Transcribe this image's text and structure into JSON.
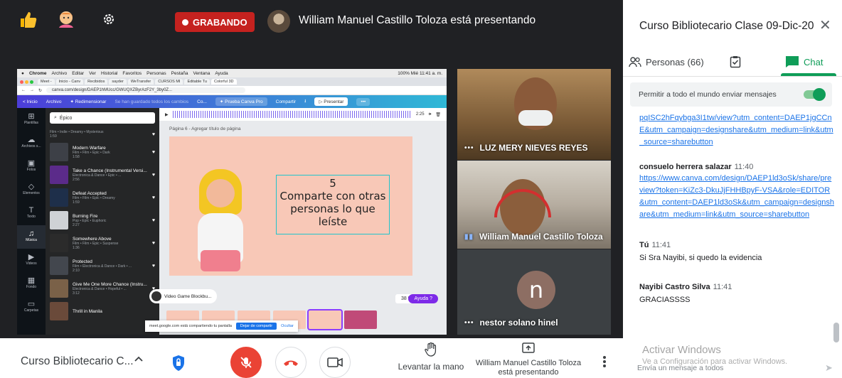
{
  "meet": {
    "recording_label": "GRABANDO",
    "presenter_title": "William Manuel Castillo Toloza está presentando",
    "icons": [
      "thumbs-up-icon",
      "emoji-icon",
      "settings-icon"
    ]
  },
  "shared_screen": {
    "mac_menu": [
      "Chrome",
      "Archivo",
      "Editar",
      "Ver",
      "Historial",
      "Favoritos",
      "Personas",
      "Pestaña",
      "Ventana",
      "Ayuda"
    ],
    "mac_status": "100% Mié 11:41 a. m.",
    "tabs": [
      "Meet - ",
      "Inicio - Canv",
      "Recibidos",
      "sayder",
      "WeTransfer",
      "CURSOS MI",
      "Editable Tu",
      "Colorful 3D"
    ],
    "url": "canva.com/design/DAEP1hMUcc/GWUQXZByrAzF2Y_3by0Z...",
    "canva_top": {
      "home": "< Inicio",
      "file": "Archivo",
      "resize": "✦ Redimensionar",
      "saved": "Se han guardado todos los cambios",
      "more": "Co...",
      "pro": "✦ Prueba Canva Pro",
      "share": "Compartir",
      "present": "▷ Presentar"
    },
    "rail": [
      "Plantillas",
      "Archivos s...",
      "Fotos",
      "Elementos",
      "Texto",
      "Música",
      "Videos",
      "Fondo",
      "Carpetas"
    ],
    "search_value": "Épico",
    "tracks": [
      {
        "title": "",
        "tags": "Film • Indie • Dreamy • Mysterious",
        "duration": "1:59"
      },
      {
        "title": "Modern Warfare",
        "tags": "Film • Film • Epic • Dark",
        "duration": "1:58"
      },
      {
        "title": "Take a Chance (Instrumental Versi...",
        "tags": "Electronica & Dance • Epic • ...",
        "duration": "2:56"
      },
      {
        "title": "Defeat Accepted",
        "tags": "Film • Film • Epic • Dreamy",
        "duration": "1:59"
      },
      {
        "title": "Burning Fire",
        "tags": "Pop • Epic • Euphoric",
        "duration": "2:27"
      },
      {
        "title": "Somewhere Above",
        "tags": "Film • Film • Epic • Suspense",
        "duration": "1:36"
      },
      {
        "title": "Protected",
        "tags": "Film • Electronica & Dance • Dark • ...",
        "duration": "2:10"
      },
      {
        "title": "Give Me One More Chance (Instru...",
        "tags": "Electronica & Dance • Hopeful • ...",
        "duration": "3:12"
      },
      {
        "title": "Thrill in Manila",
        "tags": "",
        "duration": ""
      }
    ],
    "audio_time": "2:25",
    "page_label": "Página 6 - Agregar título de página",
    "slide_number": "5",
    "slide_text": "Comparte con otras personas lo que leíste",
    "audio_pill": "Video Game Blockbu...",
    "zoom": "38 %",
    "help": "Ayuda ?",
    "share_banner": {
      "message": "meet.google.com está compartiendo tu pantalla",
      "stop": "Dejar de compartir",
      "hide": "Ocultar"
    }
  },
  "participants": [
    {
      "name": "LUZ MERY NIEVES REYES"
    },
    {
      "name": "William Manuel Castillo Toloza"
    },
    {
      "name": "nestor solano hinel",
      "initial": "n"
    }
  ],
  "bottombar": {
    "meeting_name": "Curso Bibliotecario C...",
    "raise_hand": "Levantar la mano",
    "presenting_line1": "William Manuel Castillo Toloza",
    "presenting_line2": "está presentando"
  },
  "panel": {
    "title": "Curso Bibliotecario Clase 09-Dic-20",
    "tabs": {
      "people": "Personas (66)",
      "chat": "Chat"
    },
    "allow_label": "Permitir a todo el mundo enviar mensajes",
    "messages": [
      {
        "sender": "",
        "time": "",
        "link": "pqISC2hFqybga3I1tw/view?utm_content=DAEP1jgCCnE&utm_campaign=designshare&utm_medium=link&utm_source=sharebutton",
        "text": ""
      },
      {
        "sender": "consuelo herrera salazar",
        "time": "11:40",
        "link": "https://www.canva.com/design/DAEP1ld3oSk/share/preview?token=KiZc3-DkuJjFHHBpyF-VSA&role=EDITOR&utm_content=DAEP1ld3oSk&utm_campaign=designshare&utm_medium=link&utm_source=sharebutton",
        "text": ""
      },
      {
        "sender": "Tú",
        "time": "11:41",
        "link": "",
        "text": "Si Sra Nayibi, si quedo la evidencia"
      },
      {
        "sender": "Nayibi Castro Silva",
        "time": "11:41",
        "link": "",
        "text": "GRACIASSSS"
      }
    ],
    "input_placeholder": "Envía un mensaje a todos",
    "watermark_title": "Activar Windows",
    "watermark_sub": "Ve a Configuración para activar Windows."
  }
}
